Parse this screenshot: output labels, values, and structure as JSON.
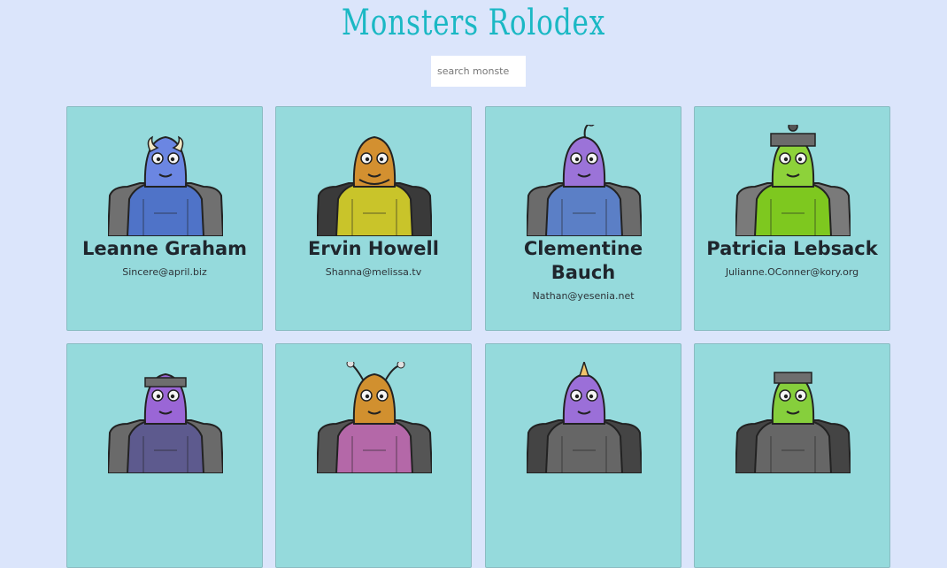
{
  "header": {
    "title": "Monsters Rolodex"
  },
  "search": {
    "placeholder": "search monsters",
    "value": ""
  },
  "monsters": [
    {
      "name": "Leanne Graham",
      "email": "Sincere@april.biz",
      "colors": {
        "skin": "#6b86e2",
        "suit": "#4f73c8",
        "shoulder": "#707070"
      }
    },
    {
      "name": "Ervin Howell",
      "email": "Shanna@melissa.tv",
      "colors": {
        "skin": "#d39030",
        "suit": "#c9c42a",
        "shoulder": "#3a3a3a"
      }
    },
    {
      "name": "Clementine Bauch",
      "email": "Nathan@yesenia.net",
      "colors": {
        "skin": "#9b73d8",
        "suit": "#5b7fc6",
        "shoulder": "#6b6b6b"
      }
    },
    {
      "name": "Patricia Lebsack",
      "email": "Julianne.OConner@kory.org",
      "colors": {
        "skin": "#8dd23a",
        "suit": "#7ec81f",
        "shoulder": "#7a7a7a"
      }
    },
    {
      "name": "",
      "email": "",
      "colors": {
        "skin": "#9a66d6",
        "suit": "#5d5a8e",
        "shoulder": "#6a6a6a"
      }
    },
    {
      "name": "",
      "email": "",
      "colors": {
        "skin": "#d1902f",
        "suit": "#b468a8",
        "shoulder": "#555555"
      }
    },
    {
      "name": "",
      "email": "",
      "colors": {
        "skin": "#9b6fd8",
        "suit": "#666666",
        "shoulder": "#444444"
      }
    },
    {
      "name": "",
      "email": "",
      "colors": {
        "skin": "#86cf3c",
        "suit": "#666666",
        "shoulder": "#444444"
      }
    }
  ]
}
